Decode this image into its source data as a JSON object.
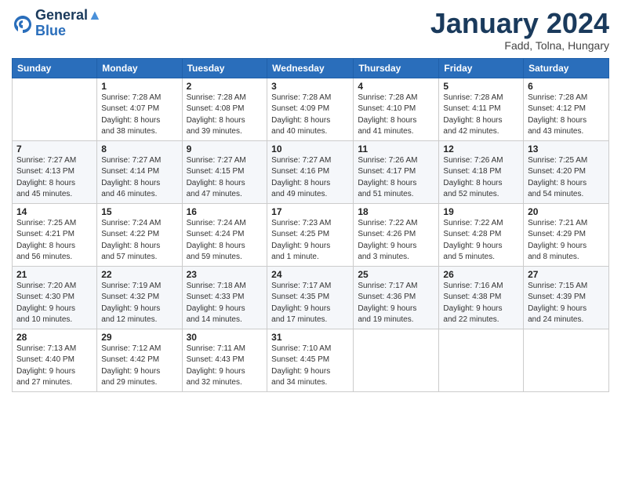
{
  "header": {
    "logo_line1": "General",
    "logo_line2": "Blue",
    "month_year": "January 2024",
    "location": "Fadd, Tolna, Hungary"
  },
  "days_of_week": [
    "Sunday",
    "Monday",
    "Tuesday",
    "Wednesday",
    "Thursday",
    "Friday",
    "Saturday"
  ],
  "weeks": [
    [
      {
        "day": "",
        "info": ""
      },
      {
        "day": "1",
        "info": "Sunrise: 7:28 AM\nSunset: 4:07 PM\nDaylight: 8 hours\nand 38 minutes."
      },
      {
        "day": "2",
        "info": "Sunrise: 7:28 AM\nSunset: 4:08 PM\nDaylight: 8 hours\nand 39 minutes."
      },
      {
        "day": "3",
        "info": "Sunrise: 7:28 AM\nSunset: 4:09 PM\nDaylight: 8 hours\nand 40 minutes."
      },
      {
        "day": "4",
        "info": "Sunrise: 7:28 AM\nSunset: 4:10 PM\nDaylight: 8 hours\nand 41 minutes."
      },
      {
        "day": "5",
        "info": "Sunrise: 7:28 AM\nSunset: 4:11 PM\nDaylight: 8 hours\nand 42 minutes."
      },
      {
        "day": "6",
        "info": "Sunrise: 7:28 AM\nSunset: 4:12 PM\nDaylight: 8 hours\nand 43 minutes."
      }
    ],
    [
      {
        "day": "7",
        "info": "Sunrise: 7:27 AM\nSunset: 4:13 PM\nDaylight: 8 hours\nand 45 minutes."
      },
      {
        "day": "8",
        "info": "Sunrise: 7:27 AM\nSunset: 4:14 PM\nDaylight: 8 hours\nand 46 minutes."
      },
      {
        "day": "9",
        "info": "Sunrise: 7:27 AM\nSunset: 4:15 PM\nDaylight: 8 hours\nand 47 minutes."
      },
      {
        "day": "10",
        "info": "Sunrise: 7:27 AM\nSunset: 4:16 PM\nDaylight: 8 hours\nand 49 minutes."
      },
      {
        "day": "11",
        "info": "Sunrise: 7:26 AM\nSunset: 4:17 PM\nDaylight: 8 hours\nand 51 minutes."
      },
      {
        "day": "12",
        "info": "Sunrise: 7:26 AM\nSunset: 4:18 PM\nDaylight: 8 hours\nand 52 minutes."
      },
      {
        "day": "13",
        "info": "Sunrise: 7:25 AM\nSunset: 4:20 PM\nDaylight: 8 hours\nand 54 minutes."
      }
    ],
    [
      {
        "day": "14",
        "info": "Sunrise: 7:25 AM\nSunset: 4:21 PM\nDaylight: 8 hours\nand 56 minutes."
      },
      {
        "day": "15",
        "info": "Sunrise: 7:24 AM\nSunset: 4:22 PM\nDaylight: 8 hours\nand 57 minutes."
      },
      {
        "day": "16",
        "info": "Sunrise: 7:24 AM\nSunset: 4:24 PM\nDaylight: 8 hours\nand 59 minutes."
      },
      {
        "day": "17",
        "info": "Sunrise: 7:23 AM\nSunset: 4:25 PM\nDaylight: 9 hours\nand 1 minute."
      },
      {
        "day": "18",
        "info": "Sunrise: 7:22 AM\nSunset: 4:26 PM\nDaylight: 9 hours\nand 3 minutes."
      },
      {
        "day": "19",
        "info": "Sunrise: 7:22 AM\nSunset: 4:28 PM\nDaylight: 9 hours\nand 5 minutes."
      },
      {
        "day": "20",
        "info": "Sunrise: 7:21 AM\nSunset: 4:29 PM\nDaylight: 9 hours\nand 8 minutes."
      }
    ],
    [
      {
        "day": "21",
        "info": "Sunrise: 7:20 AM\nSunset: 4:30 PM\nDaylight: 9 hours\nand 10 minutes."
      },
      {
        "day": "22",
        "info": "Sunrise: 7:19 AM\nSunset: 4:32 PM\nDaylight: 9 hours\nand 12 minutes."
      },
      {
        "day": "23",
        "info": "Sunrise: 7:18 AM\nSunset: 4:33 PM\nDaylight: 9 hours\nand 14 minutes."
      },
      {
        "day": "24",
        "info": "Sunrise: 7:17 AM\nSunset: 4:35 PM\nDaylight: 9 hours\nand 17 minutes."
      },
      {
        "day": "25",
        "info": "Sunrise: 7:17 AM\nSunset: 4:36 PM\nDaylight: 9 hours\nand 19 minutes."
      },
      {
        "day": "26",
        "info": "Sunrise: 7:16 AM\nSunset: 4:38 PM\nDaylight: 9 hours\nand 22 minutes."
      },
      {
        "day": "27",
        "info": "Sunrise: 7:15 AM\nSunset: 4:39 PM\nDaylight: 9 hours\nand 24 minutes."
      }
    ],
    [
      {
        "day": "28",
        "info": "Sunrise: 7:13 AM\nSunset: 4:40 PM\nDaylight: 9 hours\nand 27 minutes."
      },
      {
        "day": "29",
        "info": "Sunrise: 7:12 AM\nSunset: 4:42 PM\nDaylight: 9 hours\nand 29 minutes."
      },
      {
        "day": "30",
        "info": "Sunrise: 7:11 AM\nSunset: 4:43 PM\nDaylight: 9 hours\nand 32 minutes."
      },
      {
        "day": "31",
        "info": "Sunrise: 7:10 AM\nSunset: 4:45 PM\nDaylight: 9 hours\nand 34 minutes."
      },
      {
        "day": "",
        "info": ""
      },
      {
        "day": "",
        "info": ""
      },
      {
        "day": "",
        "info": ""
      }
    ]
  ]
}
